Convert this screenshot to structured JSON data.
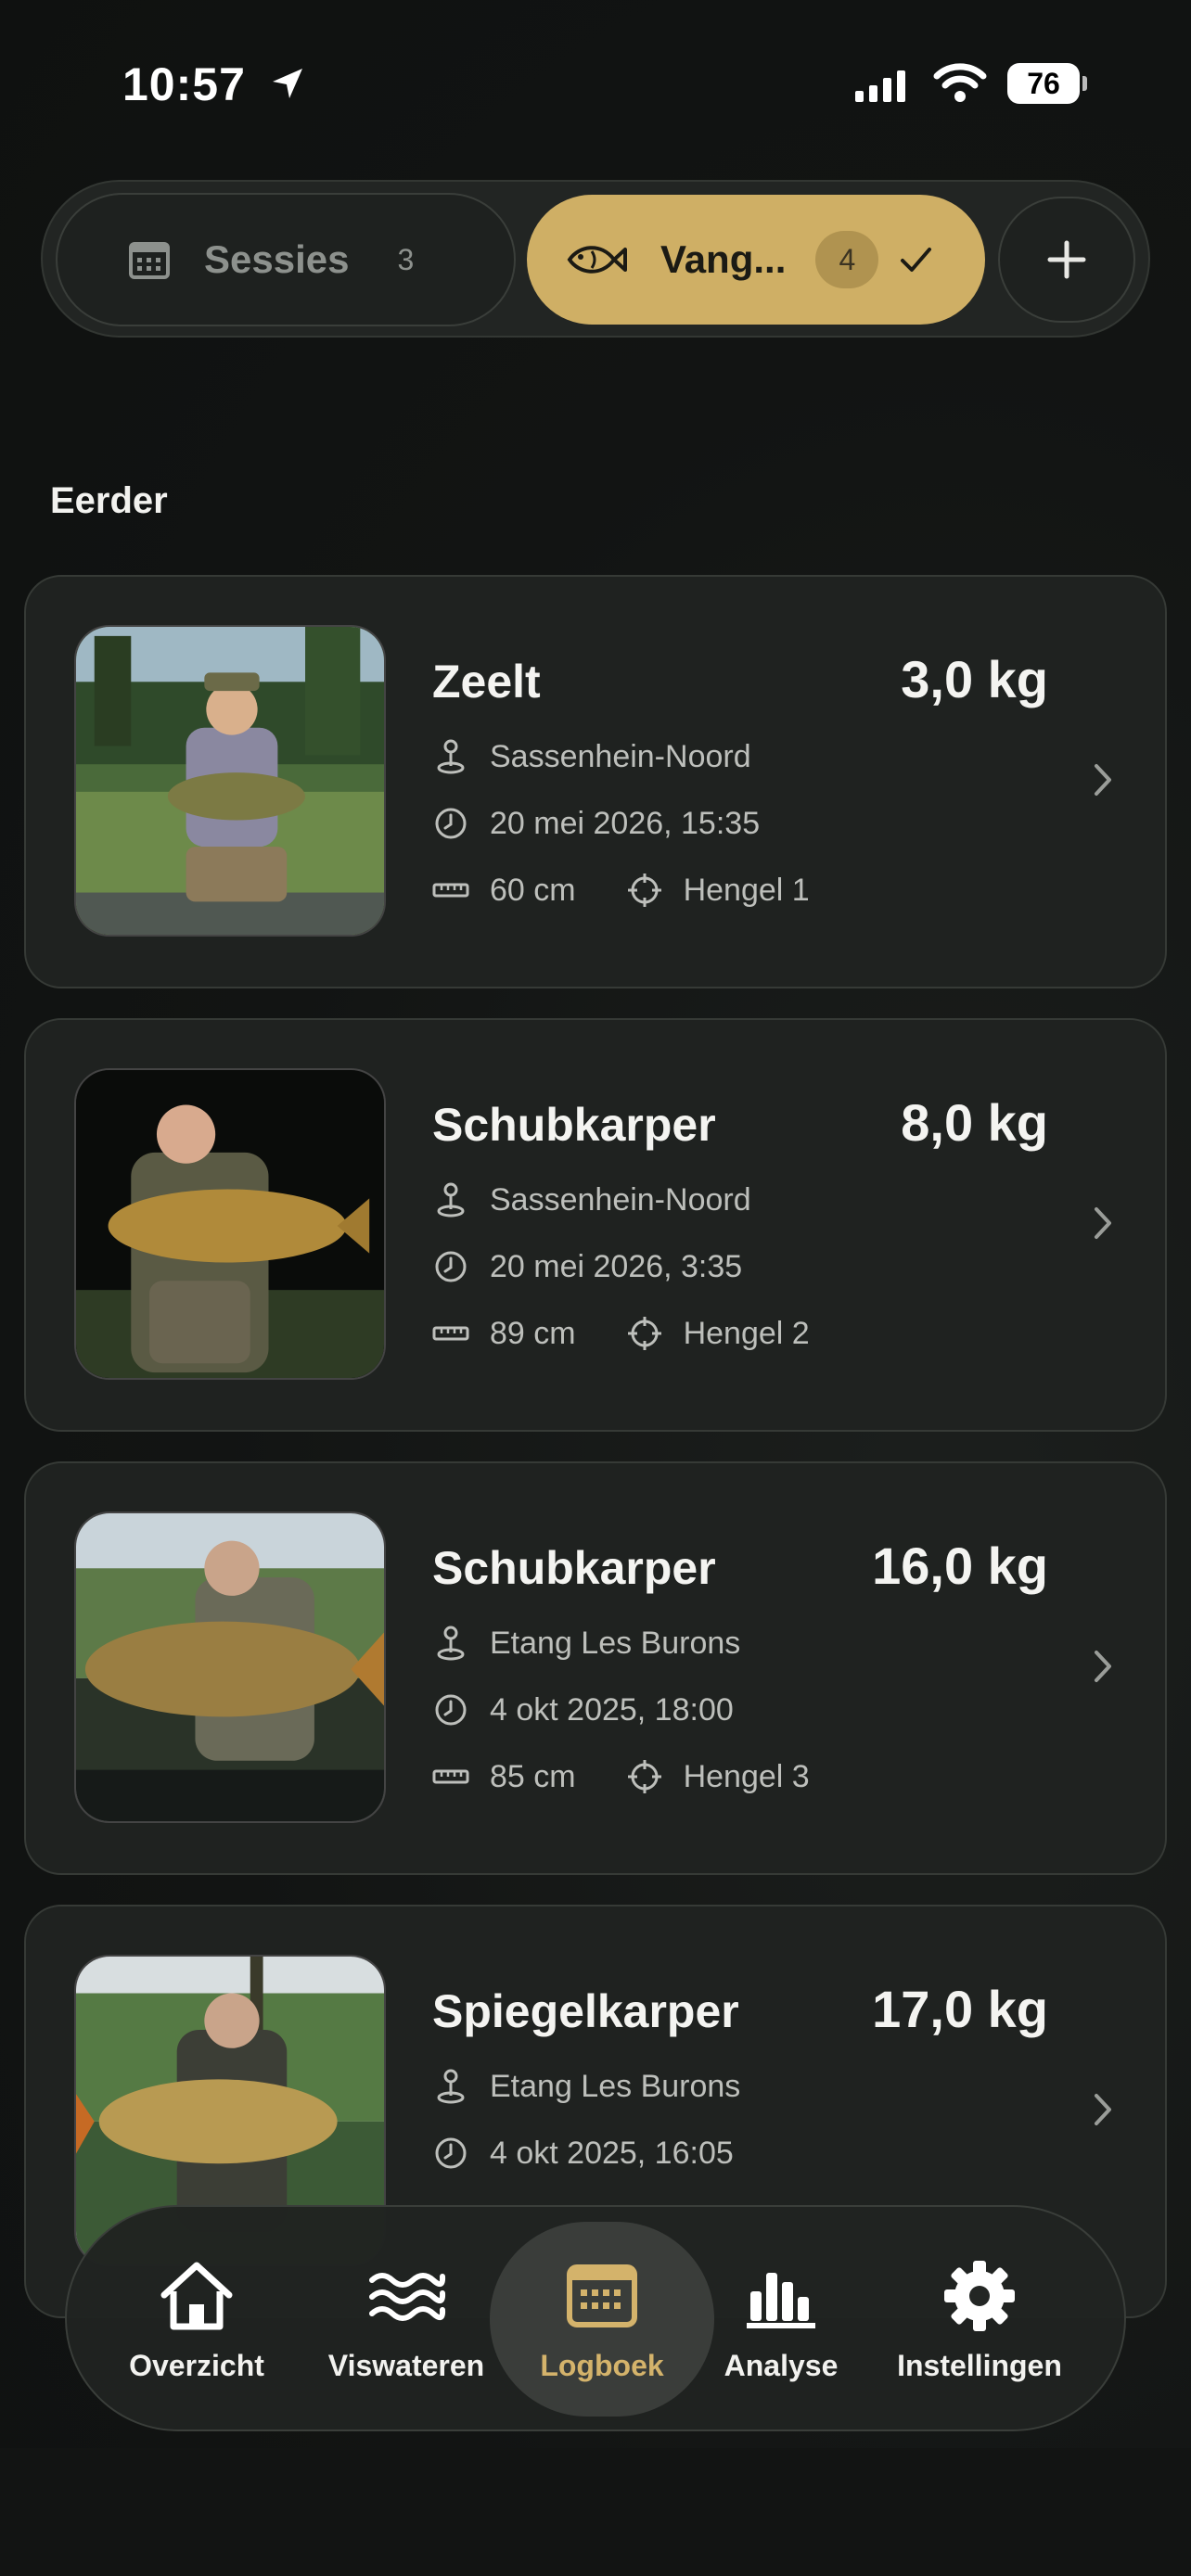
{
  "status_bar": {
    "time": "10:57",
    "battery": "76"
  },
  "segments": {
    "sessies": {
      "label": "Sessies",
      "count": "3",
      "icon": "calendar-icon"
    },
    "vangsten": {
      "label": "Vang...",
      "count": "4",
      "icon": "fish-icon",
      "selected": true
    },
    "add": {
      "icon": "plus-icon"
    }
  },
  "section_title": "Eerder",
  "catches": [
    {
      "species": "Zeelt",
      "weight": "3,0 kg",
      "location": "Sassenhein-Noord",
      "datetime": "20 mei 2026, 15:35",
      "length": "60 cm",
      "rod": "Hengel 1"
    },
    {
      "species": "Schubkarper",
      "weight": "8,0 kg",
      "location": "Sassenhein-Noord",
      "datetime": "20 mei 2026, 3:35",
      "length": "89 cm",
      "rod": "Hengel 2"
    },
    {
      "species": "Schubkarper",
      "weight": "16,0 kg",
      "location": "Etang Les Burons",
      "datetime": "4 okt 2025, 18:00",
      "length": "85 cm",
      "rod": "Hengel 3"
    },
    {
      "species": "Spiegelkarper",
      "weight": "17,0 kg",
      "location": "Etang Les Burons",
      "datetime": "4 okt 2025, 16:05",
      "length": "",
      "rod": ""
    }
  ],
  "nav": [
    {
      "label": "Overzicht",
      "icon": "home-icon"
    },
    {
      "label": "Viswateren",
      "icon": "waves-icon"
    },
    {
      "label": "Logboek",
      "icon": "logbook-calendar-icon",
      "active": true
    },
    {
      "label": "Analyse",
      "icon": "bar-chart-icon"
    },
    {
      "label": "Instellingen",
      "icon": "gear-icon"
    }
  ],
  "colors": {
    "accent": "#cfaf65",
    "background": "#121413",
    "card": "#1f2220"
  }
}
